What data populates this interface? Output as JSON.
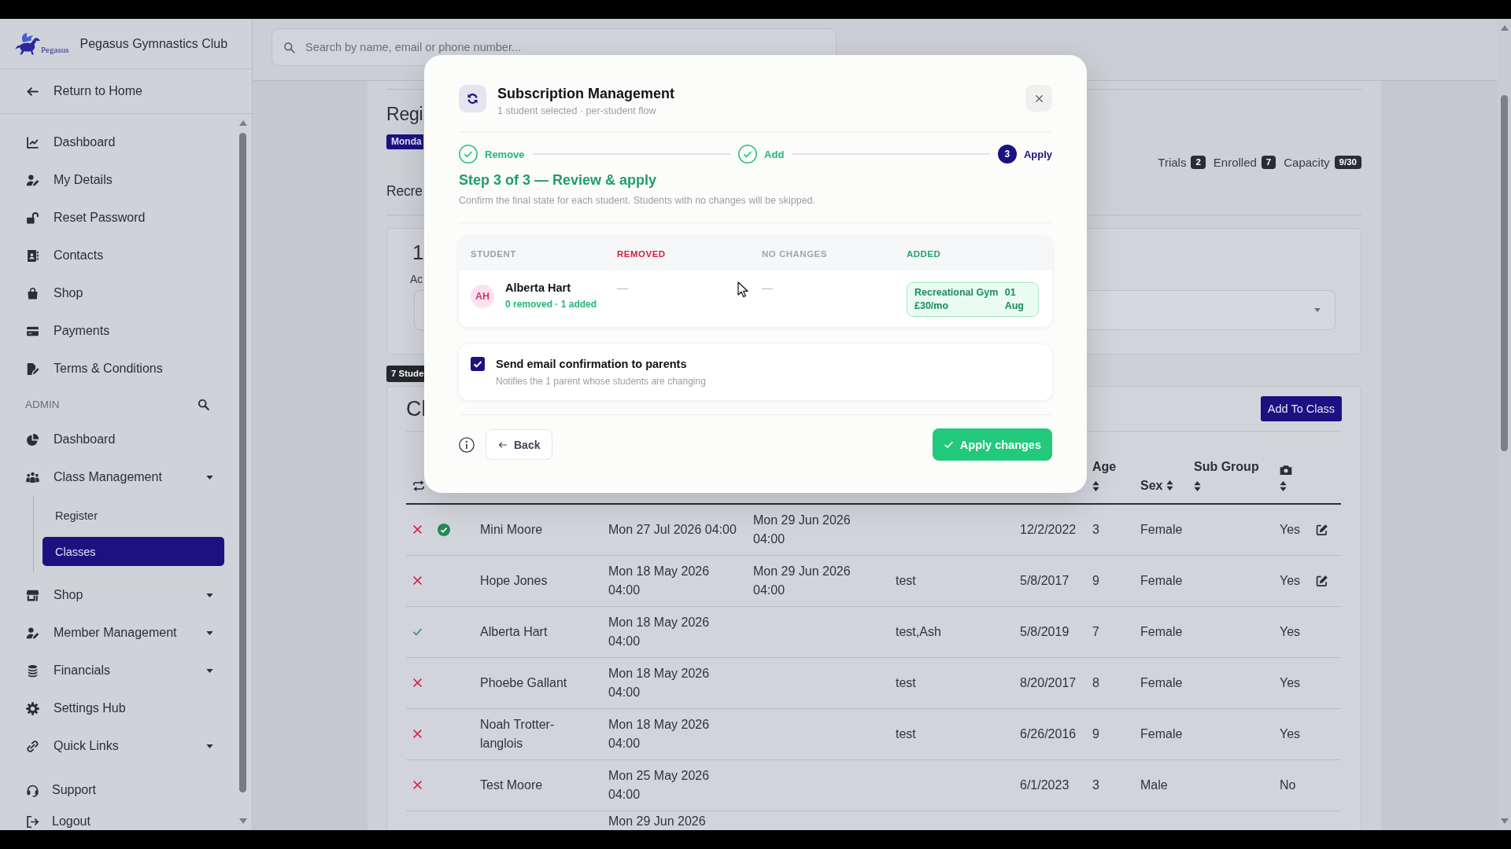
{
  "sidebar": {
    "brand": {
      "logo_text": "Pegasus",
      "name": "Pegasus Gymnastics Club"
    },
    "return_link": "Return to Home",
    "items": [
      {
        "label": "Dashboard",
        "selected": false
      },
      {
        "label": "My Details",
        "selected": false
      },
      {
        "label": "Reset Password",
        "selected": false
      },
      {
        "label": "Contacts",
        "selected": false
      },
      {
        "label": "Shop",
        "selected": false
      },
      {
        "label": "Payments",
        "selected": false
      },
      {
        "label": "Terms & Conditions",
        "selected": false
      }
    ],
    "admin": {
      "heading": "ADMIN",
      "items": [
        {
          "label": "Dashboard",
          "kind": "link",
          "selected": false
        },
        {
          "label": "Class Management",
          "kind": "group",
          "selected": false,
          "children": [
            {
              "label": "Register",
              "selected": false
            },
            {
              "label": "Classes",
              "selected": true
            }
          ]
        },
        {
          "label": "Shop",
          "kind": "group",
          "selected": false
        },
        {
          "label": "Member Management",
          "kind": "group",
          "selected": false
        },
        {
          "label": "Financials",
          "kind": "group",
          "selected": false
        },
        {
          "label": "Settings Hub",
          "kind": "link",
          "selected": false
        },
        {
          "label": "Quick Links",
          "kind": "group",
          "selected": false
        }
      ]
    },
    "footer_items": [
      {
        "label": "Support"
      },
      {
        "label": "Logout"
      }
    ]
  },
  "search": {
    "placeholder": "Search by name, email or phone number..."
  },
  "page": {
    "title": "Regi",
    "day_badge": "Monda",
    "stats": [
      {
        "label": "Trials",
        "value": "2"
      },
      {
        "label": "Enrolled",
        "value": "7"
      },
      {
        "label": "Capacity",
        "value": "9/30"
      }
    ],
    "section_title": "Recre",
    "summary": {
      "value": "1",
      "label": "Ac"
    },
    "students_badge": "7 Stude",
    "class_card": {
      "title": "Cl",
      "add_button": "Add To Class",
      "headers": {
        "age": "Age",
        "sex": "Sex",
        "sub_group": "Sub Group"
      },
      "rows": [
        {
          "tick": false,
          "circle_tick": true,
          "name": "Mini Moore",
          "first_lesson": "Mon 27 Jul 2026 04:00",
          "last_lesson": "Mon 29 Jun 2026 04:00",
          "dob": "12/2/2022",
          "age": "3",
          "sex": "Female",
          "photo": "Yes",
          "editable": true
        },
        {
          "tick": false,
          "circle_tick": false,
          "name": "Hope Jones",
          "first_lesson": "Mon 18 May 2026 04:00",
          "last_lesson": "Mon 29 Jun 2026 04:00",
          "tags": "test",
          "dob": "5/8/2017",
          "age": "9",
          "sex": "Female",
          "photo": "Yes",
          "editable": true
        },
        {
          "tick": true,
          "circle_tick": false,
          "name": "Alberta Hart",
          "first_lesson": "Mon 18 May 2026 04:00",
          "tags": "test,Ash",
          "dob": "5/8/2019",
          "age": "7",
          "sex": "Female",
          "photo": "Yes",
          "editable": false
        },
        {
          "tick": false,
          "circle_tick": false,
          "name": "Phoebe Gallant",
          "first_lesson": "Mon 18 May 2026 04:00",
          "tags": "test",
          "dob": "8/20/2017",
          "age": "8",
          "sex": "Female",
          "photo": "Yes",
          "editable": false
        },
        {
          "tick": false,
          "circle_tick": false,
          "name": "Noah Trotter-langlois",
          "first_lesson": "Mon 18 May 2026 04:00",
          "tags": "test",
          "dob": "6/26/2016",
          "age": "9",
          "sex": "Female",
          "photo": "Yes",
          "editable": false
        },
        {
          "tick": false,
          "circle_tick": false,
          "name": "Test Moore",
          "first_lesson": "Mon 25 May 2026 04:00",
          "dob": "6/1/2023",
          "age": "3",
          "sex": "Male",
          "photo": "No",
          "editable": false
        },
        {
          "first_lesson": "Mon 29 Jun 2026"
        }
      ]
    }
  },
  "modal": {
    "title": "Subscription Management",
    "subtitle": "1 student selected · per-student flow",
    "steps": [
      {
        "label": "Remove",
        "completed": true
      },
      {
        "label": "Add",
        "completed": true
      },
      {
        "label": "Apply",
        "completed": false,
        "number": "3"
      }
    ],
    "heading": "Step 3 of 3 — Review & apply",
    "description": "Confirm the final state for each student. Students with no changes will be skipped.",
    "review": {
      "columns": [
        {
          "label": "STUDENT",
          "color": "#9aa1aa"
        },
        {
          "label": "REMOVED",
          "color": "#d0213f"
        },
        {
          "label": "NO CHANGES",
          "color": "#a0a6ad"
        },
        {
          "label": "ADDED",
          "color": "#1fa56b"
        }
      ],
      "rows": [
        {
          "initials": "AH",
          "name": "Alberta Hart",
          "summary": "0 removed · 1 added",
          "removed": "—",
          "no_changes": "—",
          "added": [
            {
              "name": "Recreational Gym",
              "price": "£30/mo",
              "day": "01",
              "month": "Aug"
            }
          ]
        }
      ]
    },
    "email_option": {
      "label": "Send email confirmation to parents",
      "hint": "Notifies the 1 parent whose students are changing",
      "checked": true
    },
    "back_button": "Back",
    "apply_button": "Apply changes"
  }
}
